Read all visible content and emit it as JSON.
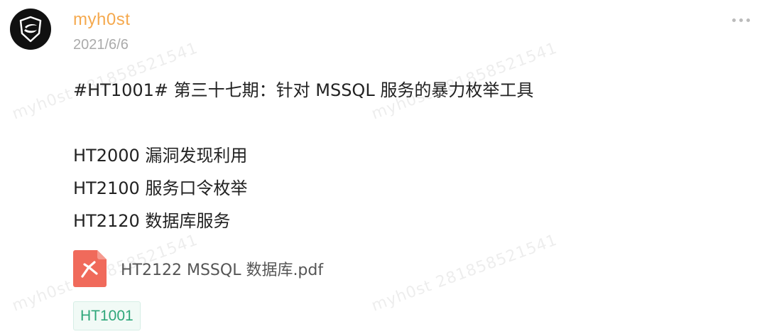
{
  "post": {
    "author": "myh0st",
    "date": "2021/6/6",
    "lines": [
      "#HT1001# 第三十七期：针对 MSSQL 服务的暴力枚举工具",
      "HT2000 漏洞发现利用",
      "HT2100 服务口令枚举",
      "HT2120 数据库服务"
    ],
    "attachment": {
      "name": "HT2122 MSSQL 数据库.pdf",
      "icon": "pdf-icon"
    },
    "tag": "HT1001"
  },
  "watermark": "myh0st 281858521541",
  "colors": {
    "author": "#f5a94e",
    "date": "#aaaaaa",
    "pdf_icon": "#f06a5b",
    "tag_text": "#2ea77a",
    "tag_bg": "#f1faf6"
  }
}
